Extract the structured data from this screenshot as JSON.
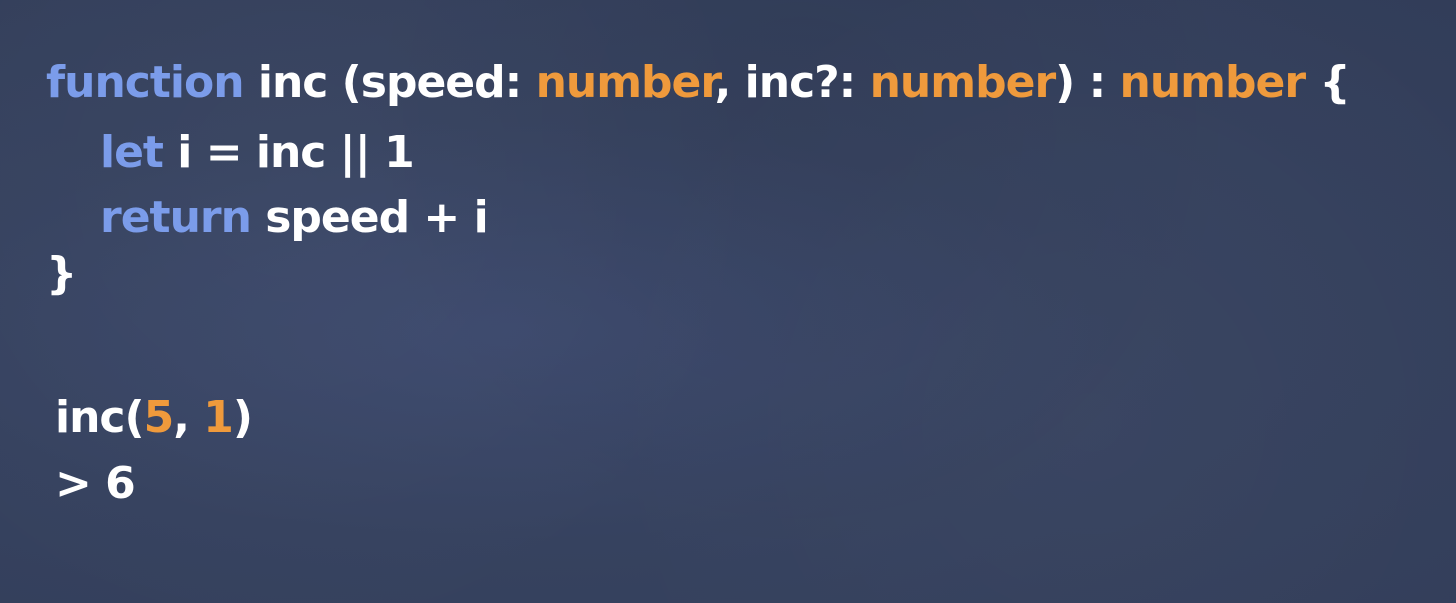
{
  "code": {
    "line1": {
      "kw_function": "function",
      "name": " inc (speed: ",
      "type1": "number",
      "mid": ", inc?: ",
      "type2": "number",
      "close": ") : ",
      "type3": "number",
      "brace": " {"
    },
    "line2": {
      "kw_let": "let",
      "rest": " i = inc || 1"
    },
    "line3": {
      "kw_return": "return",
      "rest": " speed + i"
    },
    "line4": {
      "brace": "}"
    }
  },
  "call": {
    "prefix": "inc(",
    "arg1": "5",
    "sep": ", ",
    "arg2": "1",
    "suffix": ")"
  },
  "result": {
    "text": "> 6"
  },
  "colors": {
    "background": "#36425f",
    "keyword": "#7b9cea",
    "type": "#ef9a3c",
    "plain": "#ffffff"
  }
}
